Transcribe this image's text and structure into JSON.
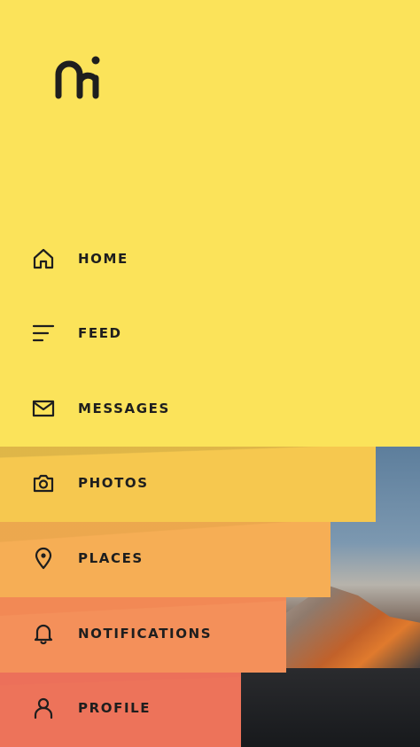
{
  "app": {
    "logo_text": "mi"
  },
  "menu": {
    "items": [
      {
        "label": "HOME",
        "icon": "home-icon"
      },
      {
        "label": "FEED",
        "icon": "feed-lines-icon"
      },
      {
        "label": "MESSAGES",
        "icon": "mail-icon"
      },
      {
        "label": "PHOTOS",
        "icon": "camera-icon"
      },
      {
        "label": "PLACES",
        "icon": "map-pin-icon"
      },
      {
        "label": "NOTIFICATIONS",
        "icon": "bell-icon"
      },
      {
        "label": "PROFILE",
        "icon": "person-icon"
      }
    ]
  },
  "colors": {
    "top_band": "#fbe35a",
    "photos_band": "#f6c84f",
    "places_band": "#f6ae55",
    "notifications_band": "#f4905a",
    "profile_band": "#ed735a",
    "text": "#1e1e1e"
  }
}
